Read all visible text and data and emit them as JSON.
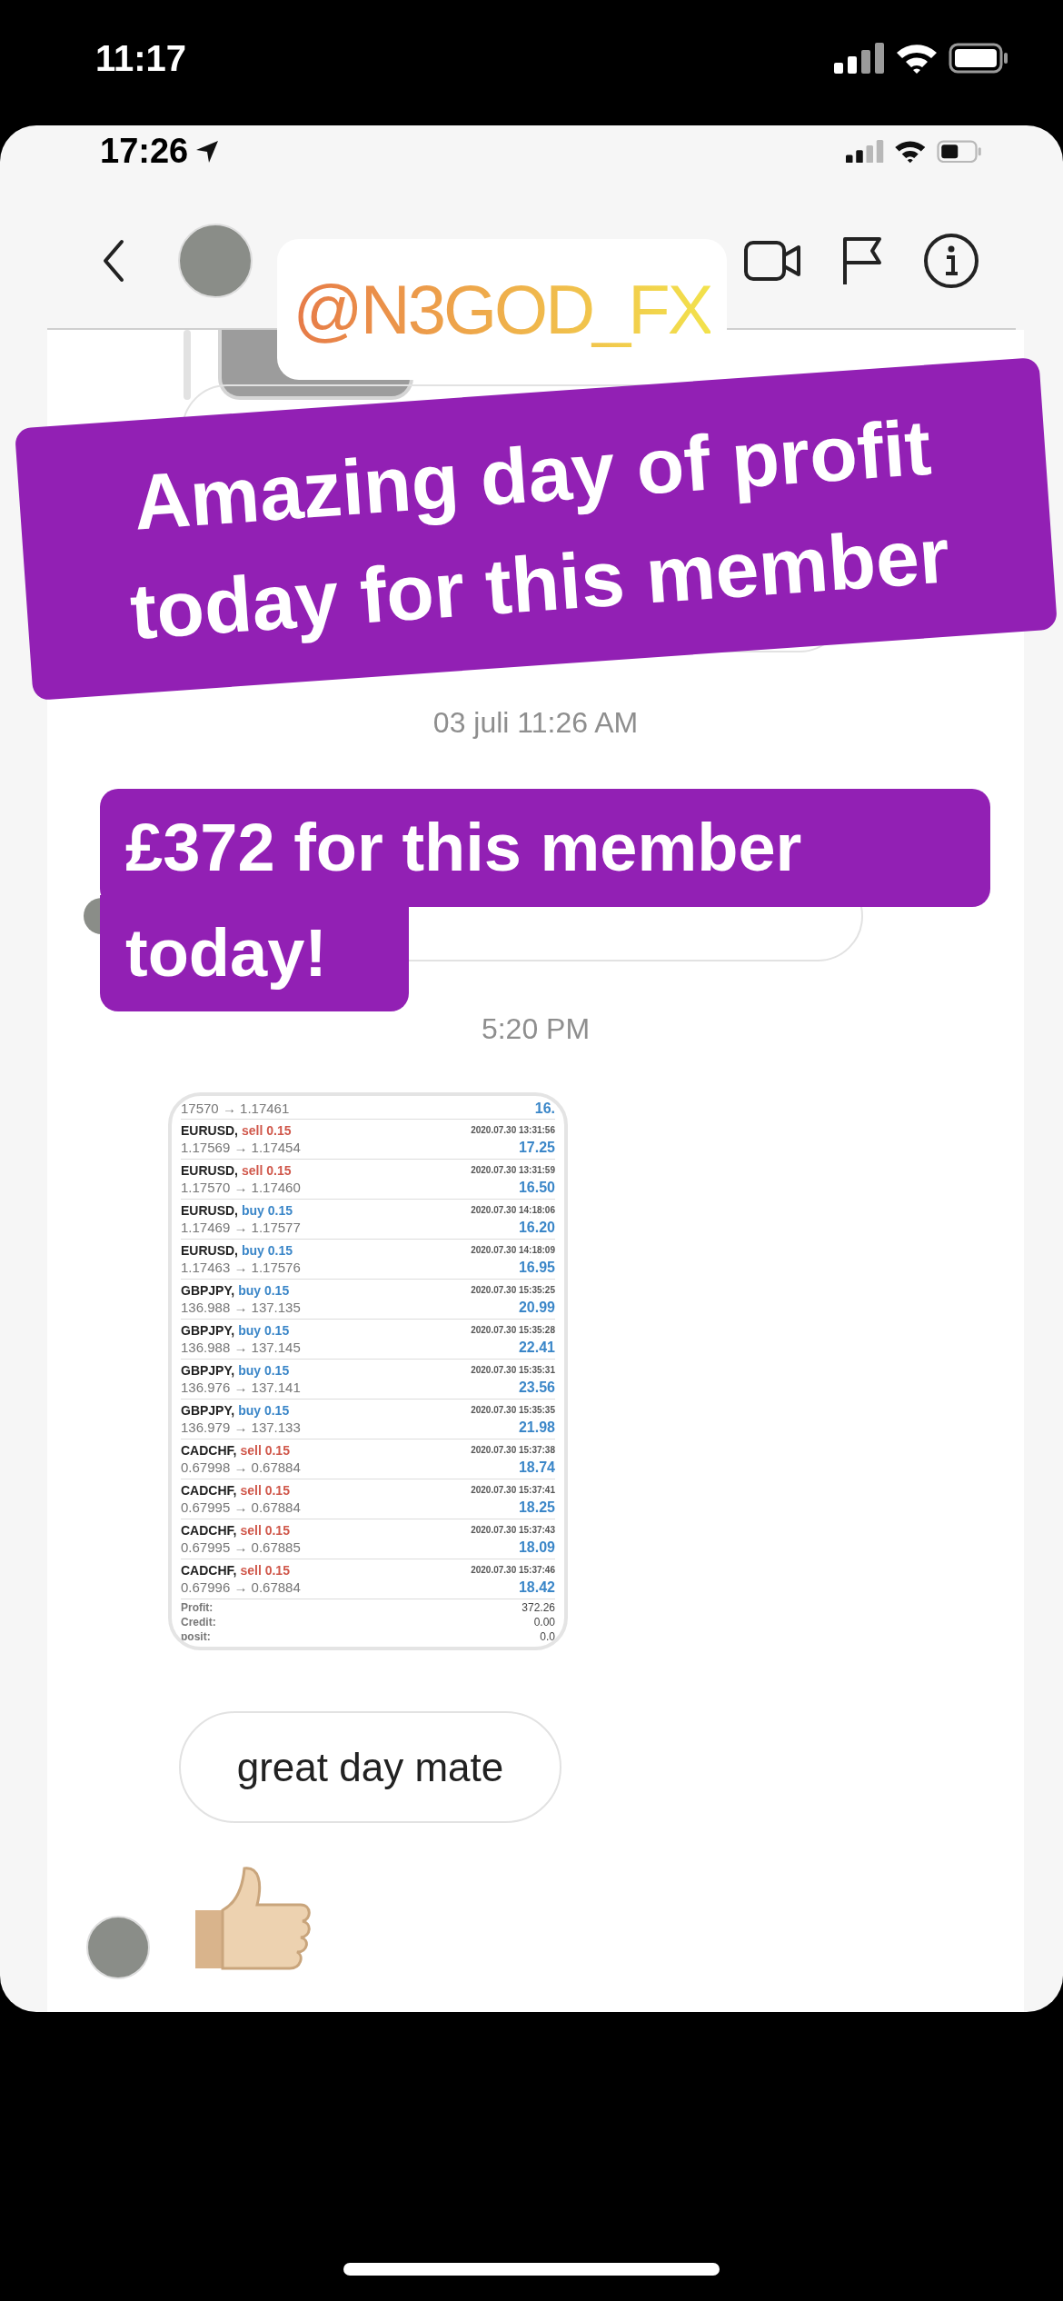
{
  "phone_status": {
    "time": "11:17"
  },
  "inner_status": {
    "time": "17:26"
  },
  "sticker_handle": "@N3GOD_FX",
  "sticker_headline": "Amazing day of profit today for this member",
  "dates": [
    "03 juli 11:26 AM",
    "5:20 PM"
  ],
  "sticker_amount": [
    "£372 for this member",
    "today!"
  ],
  "trades": {
    "top_partial": {
      "prices": "17570 → 1.17461",
      "profit": "16."
    },
    "rows": [
      {
        "pair": "EURUSD,",
        "order": "sell 0.15",
        "kind": "sell",
        "time": "2020.07.30 13:31:56",
        "prices": "1.17569 → 1.17454",
        "profit": "17.25"
      },
      {
        "pair": "EURUSD,",
        "order": "sell 0.15",
        "kind": "sell",
        "time": "2020.07.30 13:31:59",
        "prices": "1.17570 → 1.17460",
        "profit": "16.50"
      },
      {
        "pair": "EURUSD,",
        "order": "buy 0.15",
        "kind": "buy",
        "time": "2020.07.30 14:18:06",
        "prices": "1.17469 → 1.17577",
        "profit": "16.20"
      },
      {
        "pair": "EURUSD,",
        "order": "buy 0.15",
        "kind": "buy",
        "time": "2020.07.30 14:18:09",
        "prices": "1.17463 → 1.17576",
        "profit": "16.95"
      },
      {
        "pair": "GBPJPY,",
        "order": "buy 0.15",
        "kind": "buy",
        "time": "2020.07.30 15:35:25",
        "prices": "136.988 → 137.135",
        "profit": "20.99"
      },
      {
        "pair": "GBPJPY,",
        "order": "buy 0.15",
        "kind": "buy",
        "time": "2020.07.30 15:35:28",
        "prices": "136.988 → 137.145",
        "profit": "22.41"
      },
      {
        "pair": "GBPJPY,",
        "order": "buy 0.15",
        "kind": "buy",
        "time": "2020.07.30 15:35:31",
        "prices": "136.976 → 137.141",
        "profit": "23.56"
      },
      {
        "pair": "GBPJPY,",
        "order": "buy 0.15",
        "kind": "buy",
        "time": "2020.07.30 15:35:35",
        "prices": "136.979 → 137.133",
        "profit": "21.98"
      },
      {
        "pair": "CADCHF,",
        "order": "sell 0.15",
        "kind": "sell",
        "time": "2020.07.30 15:37:38",
        "prices": "0.67998 → 0.67884",
        "profit": "18.74"
      },
      {
        "pair": "CADCHF,",
        "order": "sell 0.15",
        "kind": "sell",
        "time": "2020.07.30 15:37:41",
        "prices": "0.67995 → 0.67884",
        "profit": "18.25"
      },
      {
        "pair": "CADCHF,",
        "order": "sell 0.15",
        "kind": "sell",
        "time": "2020.07.30 15:37:43",
        "prices": "0.67995 → 0.67885",
        "profit": "18.09"
      },
      {
        "pair": "CADCHF,",
        "order": "sell 0.15",
        "kind": "sell",
        "time": "2020.07.30 15:37:46",
        "prices": "0.67996 → 0.67884",
        "profit": "18.42"
      }
    ],
    "summary": [
      {
        "label": "Profit:",
        "value": "372.26"
      },
      {
        "label": "Credit:",
        "value": "0.00"
      },
      {
        "label": "posit:",
        "value": "0.0"
      }
    ]
  },
  "message": "great day mate"
}
